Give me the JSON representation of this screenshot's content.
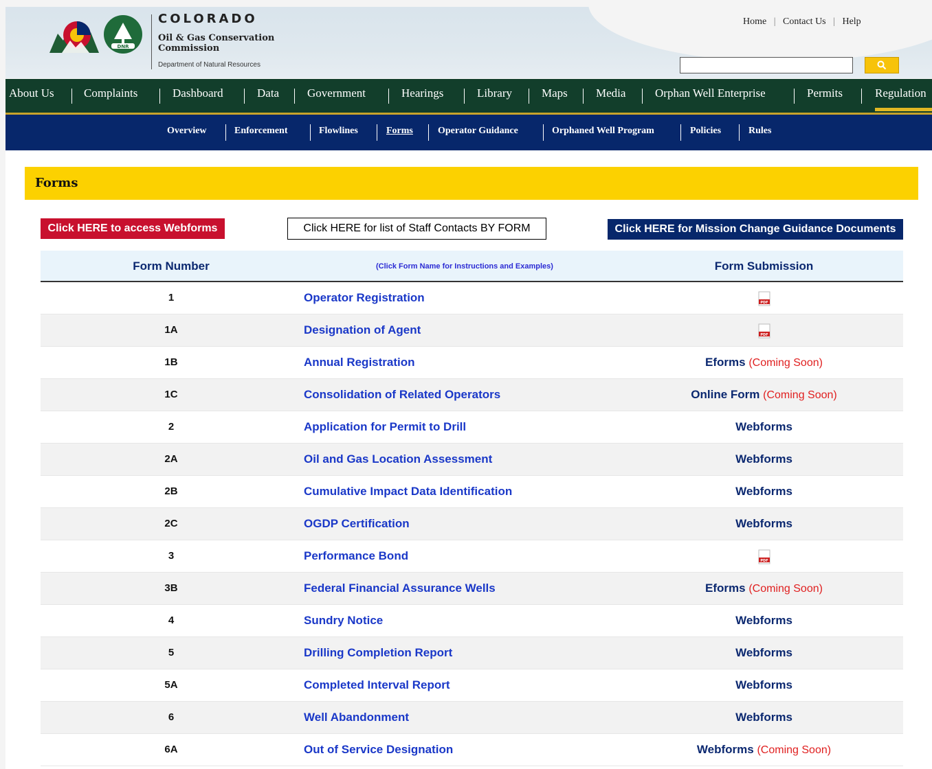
{
  "header": {
    "logo_title": "COLORADO",
    "logo_subtitle": "Oil & Gas Conservation Commission",
    "logo_department": "Department of Natural Resources",
    "toplinks": [
      "Home",
      "Contact Us",
      "Help"
    ],
    "search": {
      "value": "",
      "placeholder": ""
    }
  },
  "mainnav": {
    "items": [
      "About Us",
      "Complaints",
      "Dashboard",
      "Data",
      "Government",
      "Hearings",
      "Library",
      "Maps",
      "Media",
      "Orphan Well Enterprise",
      "Permits",
      "Regulation"
    ],
    "active": "Regulation"
  },
  "subnav": {
    "items": [
      "Overview",
      "Enforcement",
      "Flowlines",
      "Forms",
      "Operator Guidance",
      "Orphaned Well Program",
      "Policies",
      "Rules"
    ],
    "current": "Forms"
  },
  "section": {
    "title": "Forms"
  },
  "buttons": {
    "webforms": "Click HERE to access Webforms",
    "staff_contacts": "Click HERE for list of Staff Contacts BY FORM",
    "mission_prefix": "Click HERE for ",
    "mission_bold": "Mission Change Guidance Documents"
  },
  "table": {
    "headers": {
      "form_number": "Form Number",
      "form_name_hint": "(Click Form Name for Instructions and Examples)",
      "form_submission": "Form Submission"
    },
    "coming_soon": "(Coming Soon)",
    "rows": [
      {
        "num": "1",
        "name": "Operator Registration",
        "submission": "",
        "pdf": true,
        "coming_soon": false
      },
      {
        "num": "1A",
        "name": "Designation of Agent",
        "submission": "",
        "pdf": true,
        "coming_soon": false
      },
      {
        "num": "1B",
        "name": "Annual Registration",
        "submission": "Eforms",
        "pdf": false,
        "coming_soon": true
      },
      {
        "num": "1C",
        "name": "Consolidation of Related Operators",
        "submission": "Online Form",
        "pdf": false,
        "coming_soon": true
      },
      {
        "num": "2",
        "name": "Application for Permit to Drill",
        "submission": "Webforms",
        "pdf": false,
        "coming_soon": false
      },
      {
        "num": "2A",
        "name": "Oil and Gas Location Assessment",
        "submission": "Webforms",
        "pdf": false,
        "coming_soon": false
      },
      {
        "num": "2B",
        "name": "Cumulative Impact Data Identification",
        "submission": "Webforms",
        "pdf": false,
        "coming_soon": false
      },
      {
        "num": "2C",
        "name": "OGDP Certification",
        "submission": "Webforms",
        "pdf": false,
        "coming_soon": false
      },
      {
        "num": "3",
        "name": "Performance Bond",
        "submission": "",
        "pdf": true,
        "coming_soon": false
      },
      {
        "num": "3B",
        "name": "Federal Financial Assurance Wells",
        "submission": "Eforms",
        "pdf": false,
        "coming_soon": true
      },
      {
        "num": "4",
        "name": "Sundry Notice",
        "submission": "Webforms",
        "pdf": false,
        "coming_soon": false
      },
      {
        "num": "5",
        "name": "Drilling Completion Report",
        "submission": "Webforms",
        "pdf": false,
        "coming_soon": false
      },
      {
        "num": "5A",
        "name": "Completed Interval Report",
        "submission": "Webforms",
        "pdf": false,
        "coming_soon": false
      },
      {
        "num": "6",
        "name": "Well Abandonment",
        "submission": "Webforms",
        "pdf": false,
        "coming_soon": false
      },
      {
        "num": "6A",
        "name": "Out of Service Designation",
        "submission": "Webforms",
        "pdf": false,
        "coming_soon": true
      }
    ]
  },
  "colors": {
    "main_nav_bg": "#123e2b",
    "sub_nav_bg": "#07276b",
    "section_bar": "#fcd100",
    "link_blue": "#1a38c8",
    "coming_soon_red": "#e02020",
    "webforms_button_red": "#c8102e"
  }
}
